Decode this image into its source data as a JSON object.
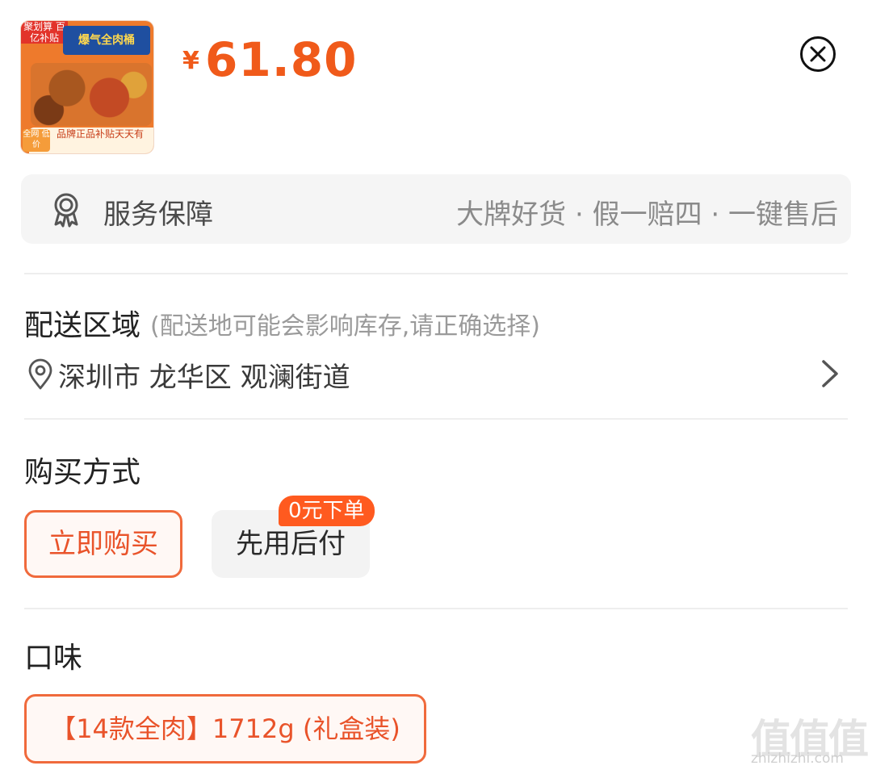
{
  "product": {
    "image_tag": "聚划算 百亿补贴",
    "image_title": "爆气全肉桶",
    "image_badge": "全网 低价",
    "image_banner": "品牌正品补贴天天有",
    "currency_symbol": "¥",
    "price": "61.80"
  },
  "service": {
    "label": "服务保障",
    "description": "大牌好货 · 假一赔四 · 一键售后"
  },
  "delivery": {
    "title": "配送区域",
    "hint": "(配送地可能会影响库存,请正确选择)",
    "address": "深圳市 龙华区 观澜街道"
  },
  "purchase": {
    "title": "购买方式",
    "options": [
      {
        "label": "立即购买",
        "selected": true
      },
      {
        "label": "先用后付",
        "selected": false
      }
    ],
    "promo_badge": "0元下单"
  },
  "flavor": {
    "title": "口味",
    "options": [
      {
        "label": "【14款全肉】1712g (礼盒装)",
        "selected": true
      }
    ]
  },
  "watermark": {
    "mark": "值值值",
    "url": "zhizhizhi.com"
  },
  "colors": {
    "accent": "#f05a1a",
    "selected_border": "#f06a3c",
    "badge_bg": "#ff5a1f"
  },
  "icons": [
    "thumbnail-image",
    "close-circle-icon",
    "certificate-icon",
    "location-pin-icon",
    "chevron-right-icon"
  ]
}
